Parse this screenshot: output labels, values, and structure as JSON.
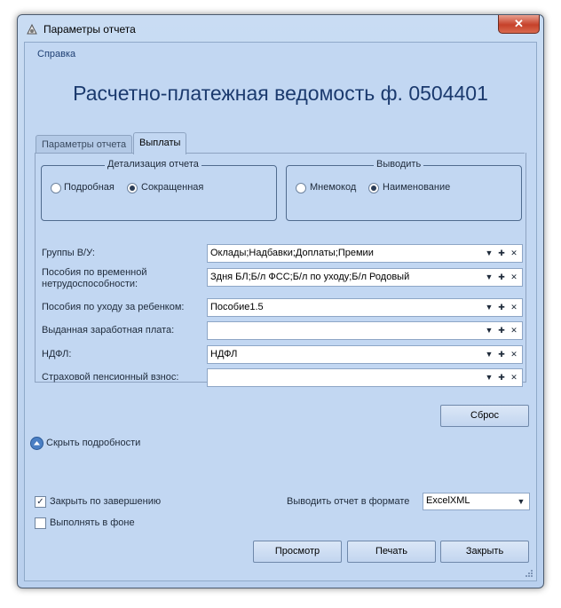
{
  "window": {
    "title": "Параметры отчета",
    "close_label": "✕"
  },
  "menu": {
    "help": "Справка"
  },
  "report": {
    "title": "Расчетно-платежная ведомость ф. 0504401"
  },
  "tabs": [
    {
      "label": "Параметры отчета",
      "active": false
    },
    {
      "label": "Выплаты",
      "active": true
    }
  ],
  "detail_group": {
    "legend": "Детализация отчета",
    "options": [
      "Подробная",
      "Сокращенная"
    ],
    "selected": "Сокращенная"
  },
  "output_group": {
    "legend": "Выводить",
    "options": [
      "Мнемокод",
      "Наименование"
    ],
    "selected": "Наименование"
  },
  "fields": [
    {
      "label": "Группы В/У:",
      "value": "Оклады;Надбавки;Доплаты;Премии"
    },
    {
      "label": "Пособия по временной нетрудоспособности:",
      "value": "Здня БЛ;Б/л ФСС;Б/л по уходу;Б/л Родовый"
    },
    {
      "label": "Пособия по уходу за ребенком:",
      "value": "Пособие1.5"
    },
    {
      "label": "Выданная заработная плата:",
      "value": ""
    },
    {
      "label": "НДФЛ:",
      "value": "НДФЛ"
    },
    {
      "label": "Страховой пенсионный взнос:",
      "value": ""
    }
  ],
  "buttons": {
    "reset": "Сброс",
    "preview": "Просмотр",
    "print": "Печать",
    "close": "Закрыть"
  },
  "details_toggle": "Скрыть подробности",
  "options": {
    "close_on_finish": {
      "label": "Закрыть по завершению",
      "checked": true
    },
    "run_background": {
      "label": "Выполнять в фоне",
      "checked": false
    }
  },
  "format": {
    "label": "Выводить отчет в формате",
    "value": "ExcelXML"
  },
  "colors": {
    "title": "#1b3a6e",
    "client": "#c2d7f2",
    "close": "#c6412a"
  }
}
